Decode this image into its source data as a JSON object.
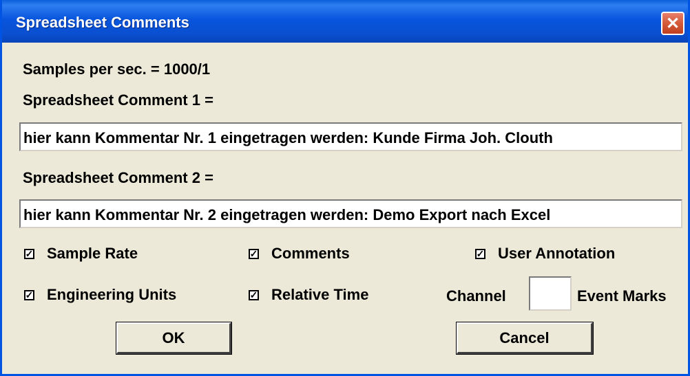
{
  "window": {
    "title": "Spreadsheet Comments",
    "close_symbol": "✕"
  },
  "info": {
    "samples_label": "Samples per sec. = 1000/1",
    "comment1_label": "Spreadsheet Comment 1 =",
    "comment1_value": "hier kann Kommentar Nr. 1 eingetragen werden: Kunde Firma Joh. Clouth",
    "comment2_label": "Spreadsheet Comment 2 =",
    "comment2_value": "hier kann Kommentar Nr. 2 eingetragen werden: Demo Export nach Excel"
  },
  "options": {
    "check_mark": "✓",
    "sample_rate": "Sample Rate",
    "comments": "Comments",
    "user_annotation": "User Annotation",
    "engineering_units": "Engineering Units",
    "relative_time": "Relative Time"
  },
  "channel": {
    "label": "Channel",
    "value": "",
    "event_marks": "Event Marks"
  },
  "buttons": {
    "ok": "OK",
    "cancel": "Cancel"
  }
}
